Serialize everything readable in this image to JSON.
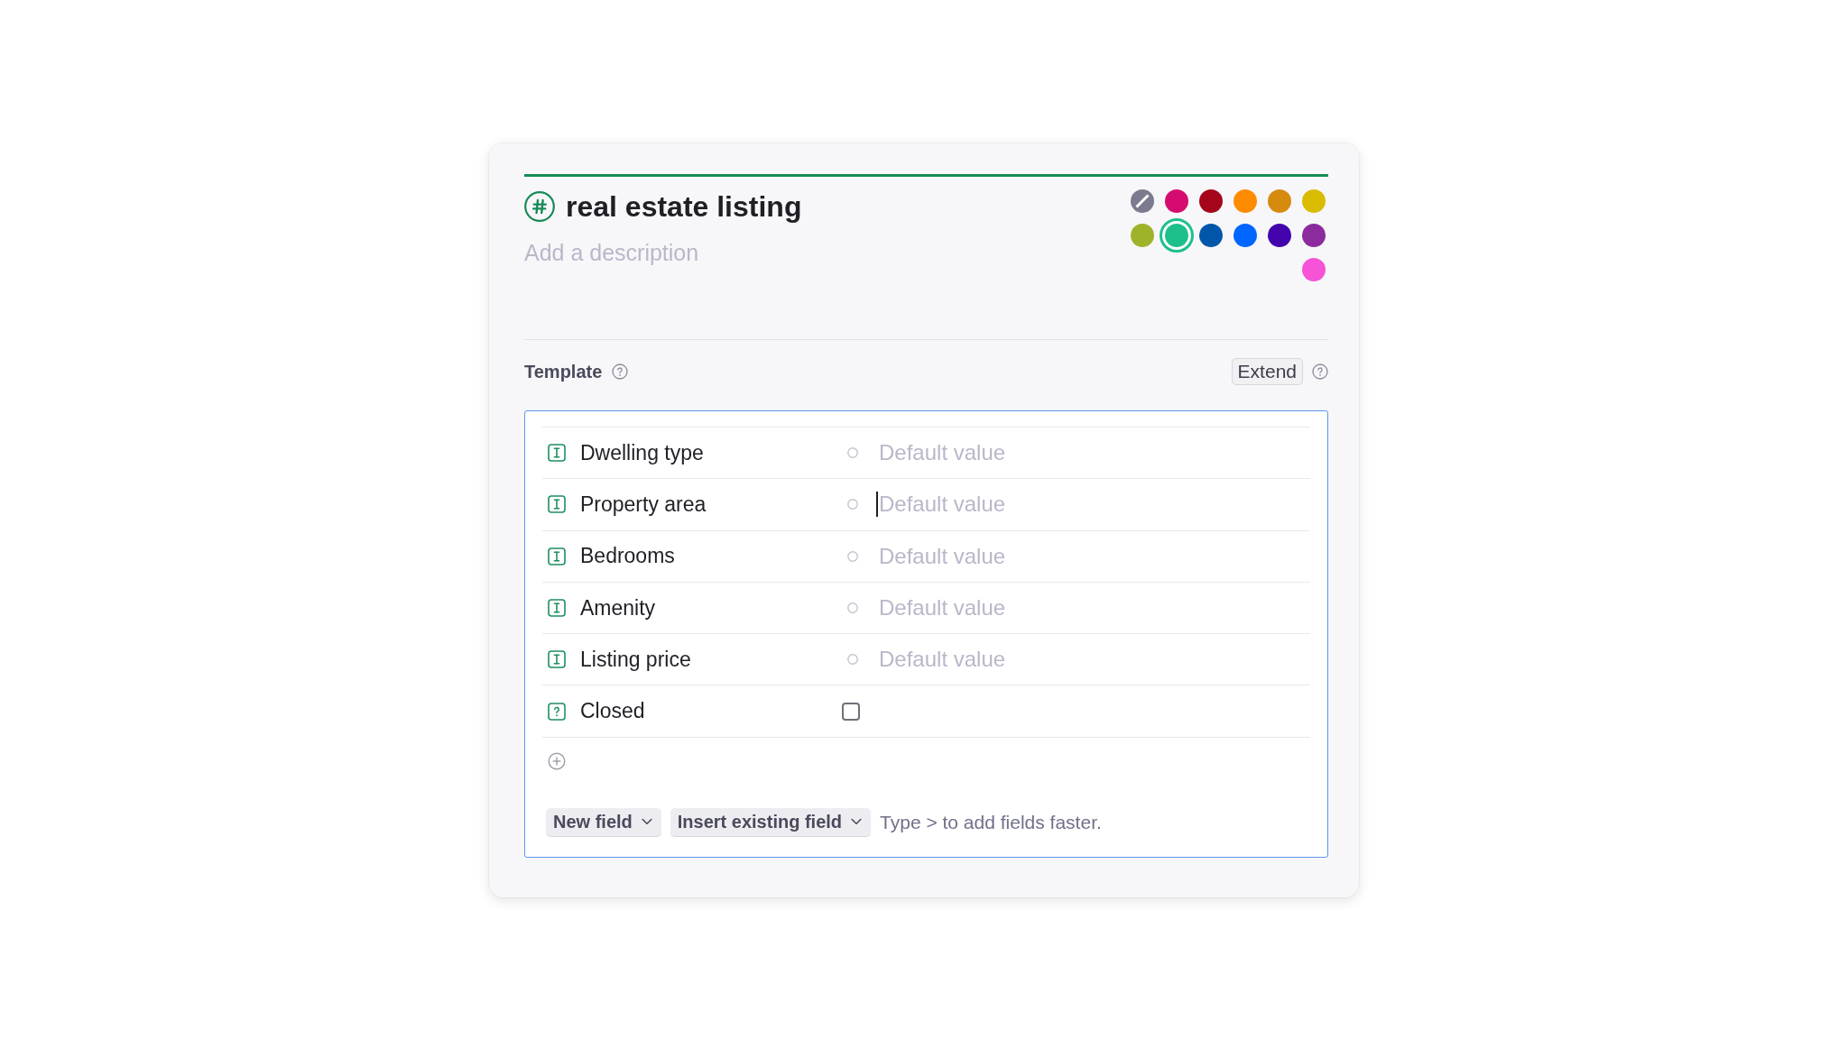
{
  "header": {
    "title": "real estate listing",
    "description": {
      "placeholder": "Add a description"
    }
  },
  "colors": [
    {
      "kind": "none",
      "color": "#7b7a8e",
      "selected": false
    },
    {
      "kind": "color",
      "color": "#d50b6f",
      "selected": false
    },
    {
      "kind": "color",
      "color": "#a5051a",
      "selected": false
    },
    {
      "kind": "color",
      "color": "#ff8c00",
      "selected": false
    },
    {
      "kind": "color",
      "color": "#d68b0f",
      "selected": false
    },
    {
      "kind": "color",
      "color": "#d9bc00",
      "selected": false
    },
    {
      "kind": "color",
      "color": "#a0b22a",
      "selected": false
    },
    {
      "kind": "color",
      "color": "#1dc08c",
      "selected": true
    },
    {
      "kind": "color",
      "color": "#0057a9",
      "selected": false
    },
    {
      "kind": "color",
      "color": "#0066ff",
      "selected": false
    },
    {
      "kind": "color",
      "color": "#4304ad",
      "selected": false
    },
    {
      "kind": "color",
      "color": "#8b2b9e",
      "selected": false
    },
    {
      "kind": "color",
      "color": "#f653d6",
      "selected": false
    }
  ],
  "template": {
    "label": "Template",
    "extend_button": "Extend",
    "fields": [
      {
        "kind": "text",
        "name": "Dwelling type",
        "placeholder": "Default value",
        "focused": false
      },
      {
        "kind": "text",
        "name": "Property area",
        "placeholder": "Default value",
        "focused": true
      },
      {
        "kind": "text",
        "name": "Bedrooms",
        "placeholder": "Default value",
        "focused": false
      },
      {
        "kind": "text",
        "name": "Amenity",
        "placeholder": "Default value",
        "focused": false
      },
      {
        "kind": "text",
        "name": "Listing price",
        "placeholder": "Default value",
        "focused": false
      },
      {
        "kind": "boolean",
        "name": "Closed",
        "checked": false,
        "focused": false
      }
    ],
    "actions": [
      {
        "label": "New field"
      },
      {
        "label": "Insert existing field"
      }
    ],
    "hint": "Type > to add fields faster."
  }
}
